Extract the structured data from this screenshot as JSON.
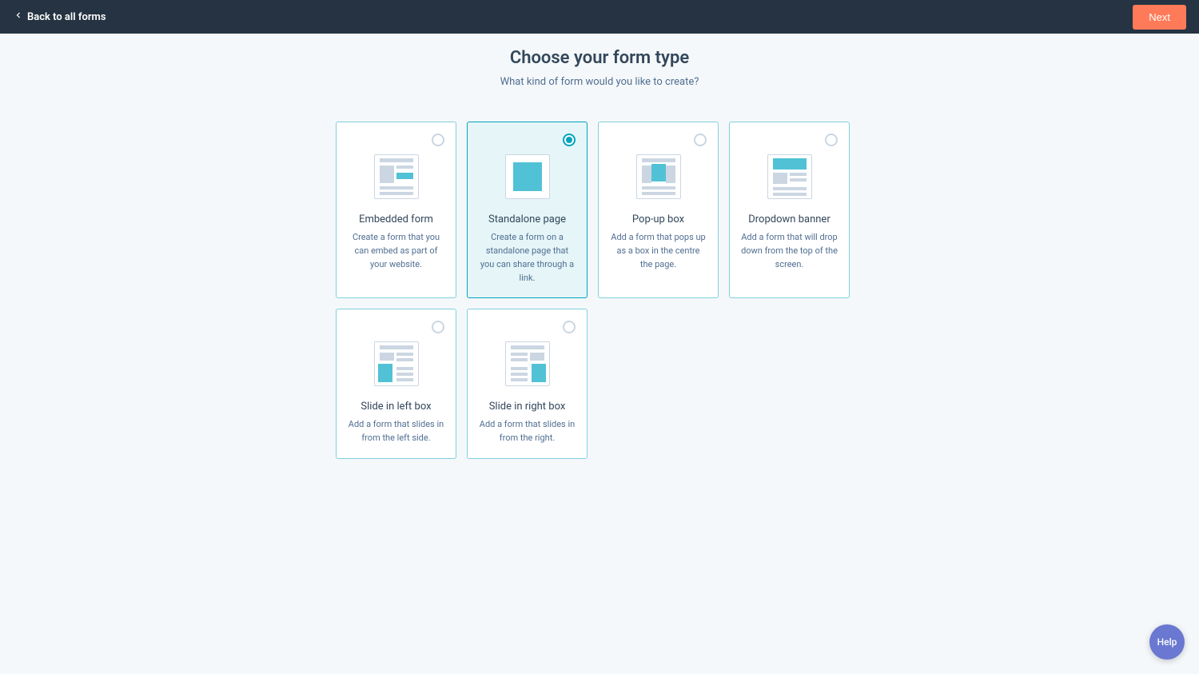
{
  "header": {
    "back_label": "Back to all forms",
    "next_label": "Next"
  },
  "page": {
    "title": "Choose your form type",
    "subtitle": "What kind of form would you like to create?"
  },
  "cards": [
    {
      "id": "embedded",
      "title": "Embedded form",
      "desc": "Create a form that you can embed as part of your website.",
      "selected": false
    },
    {
      "id": "standalone",
      "title": "Standalone page",
      "desc": "Create a form on a standalone page that you can share through a link.",
      "selected": true
    },
    {
      "id": "popup",
      "title": "Pop-up box",
      "desc": "Add a form that pops up as a box in the centre the page.",
      "selected": false
    },
    {
      "id": "dropdown",
      "title": "Dropdown banner",
      "desc": "Add a form that will drop down from the top of the screen.",
      "selected": false
    },
    {
      "id": "slide-left",
      "title": "Slide in left box",
      "desc": "Add a form that slides in from the left side.",
      "selected": false
    },
    {
      "id": "slide-right",
      "title": "Slide in right box",
      "desc": "Add a form that slides in from the right.",
      "selected": false
    }
  ],
  "help": {
    "label": "Help"
  }
}
